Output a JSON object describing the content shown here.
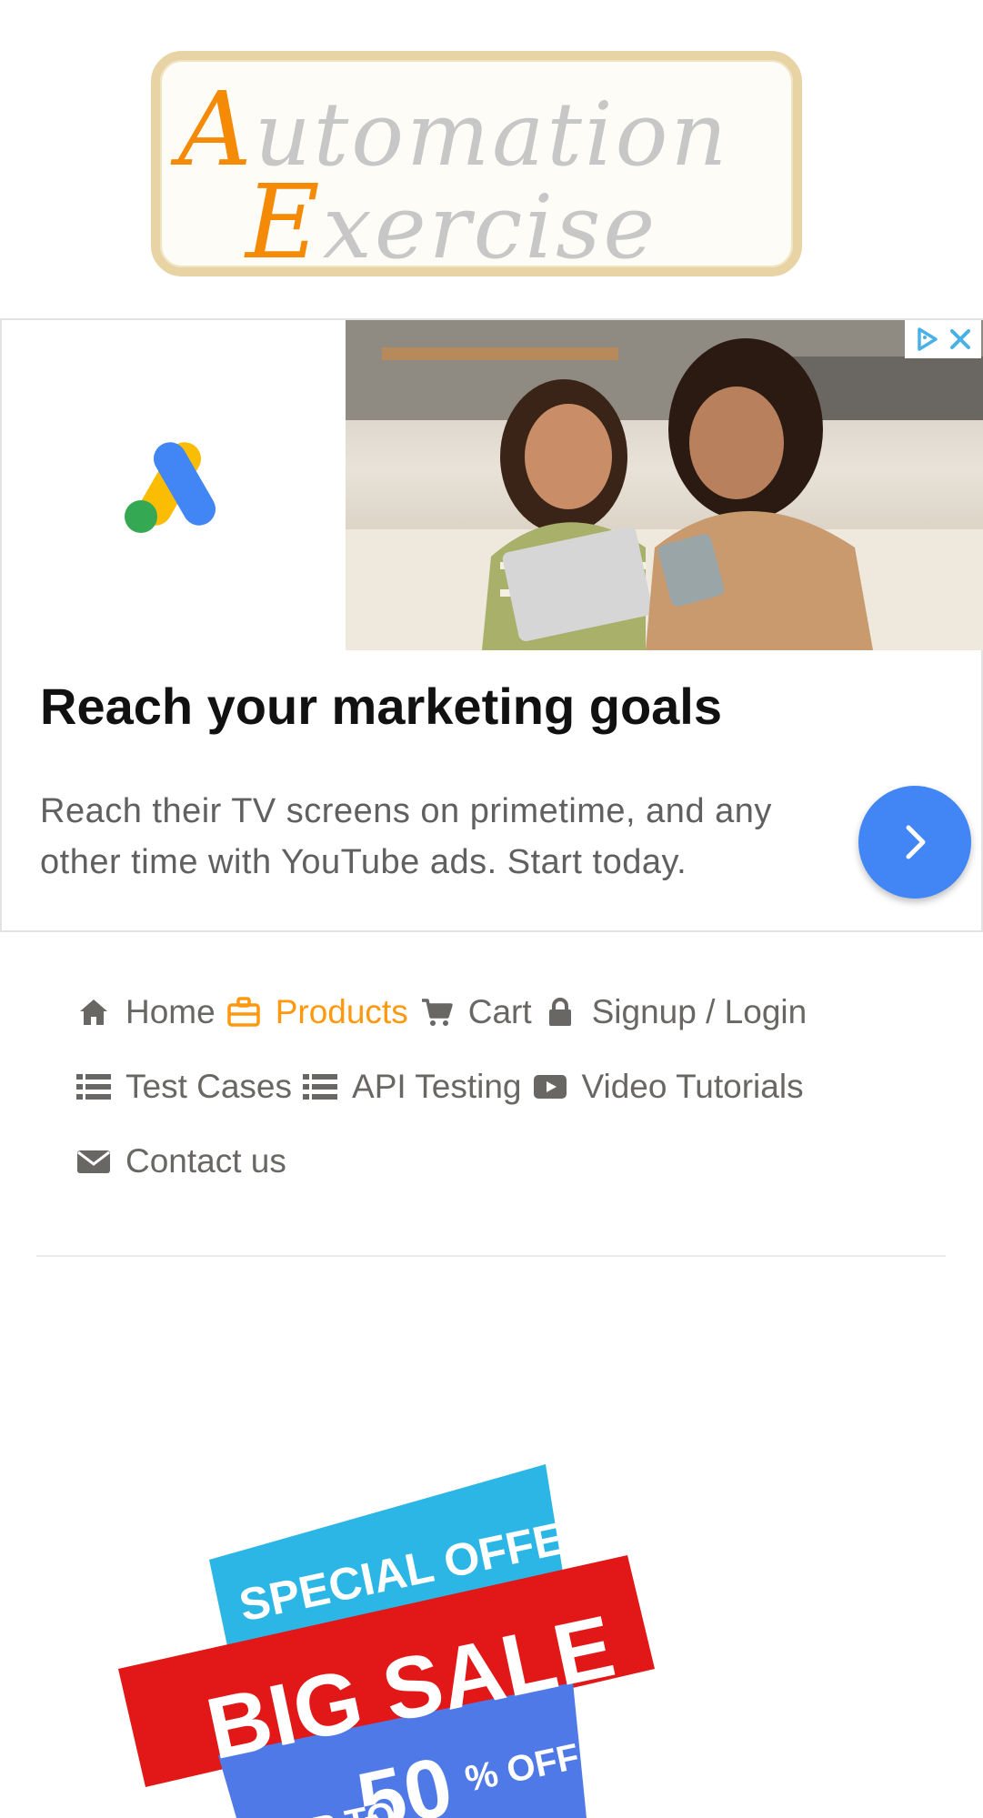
{
  "logo": {
    "line1_cap": "A",
    "line1_rest": "utomation",
    "line2_cap": "E",
    "line2_rest": "xercise"
  },
  "ad": {
    "title": "Reach your marketing goals",
    "description": "Reach their TV screens on primetime, and any other time with YouTube ads. Start today.",
    "brand_colors": {
      "yellow": "#fbbc04",
      "green": "#34a853",
      "blue": "#4285f4"
    }
  },
  "nav": {
    "items": [
      {
        "label": "Home",
        "icon": "home-icon"
      },
      {
        "label": "Products",
        "icon": "briefcase-icon",
        "active": true
      },
      {
        "label": "Cart",
        "icon": "cart-icon"
      },
      {
        "label": "Signup / Login",
        "icon": "lock-icon"
      },
      {
        "label": "Test Cases",
        "icon": "list-icon"
      },
      {
        "label": "API Testing",
        "icon": "list-icon"
      },
      {
        "label": "Video Tutorials",
        "icon": "youtube-play-icon"
      },
      {
        "label": "Contact us",
        "icon": "envelope-icon"
      }
    ],
    "active_color": "#fe980f",
    "text_color": "#696763"
  },
  "promo": {
    "line1": "SPECIAL OFFER",
    "line2": "BIG SALE",
    "line3_prefix": "UP TO",
    "line3_value": "50",
    "line3_suffix": "% OFF"
  }
}
